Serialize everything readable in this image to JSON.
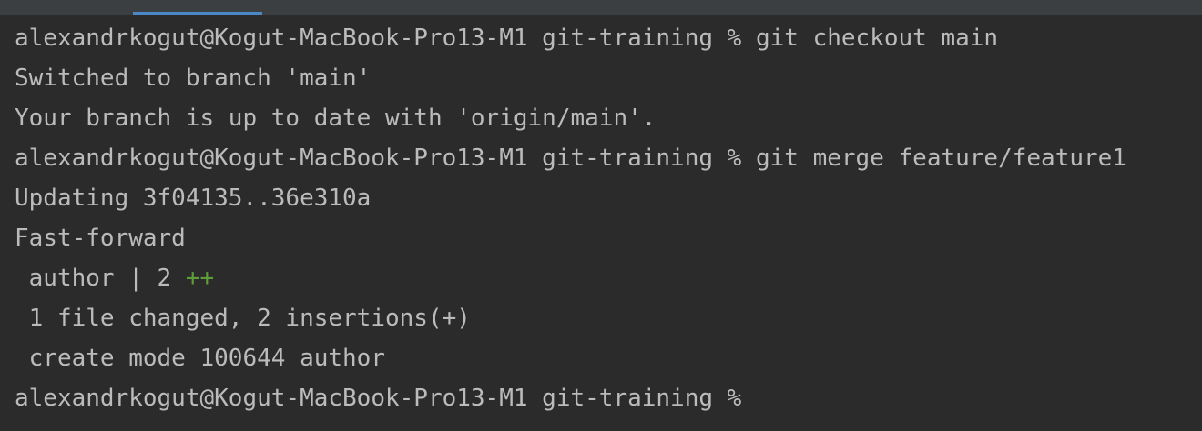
{
  "colors": {
    "background": "#2b2b2b",
    "text": "#bbbbbb",
    "tab_strip": "#3c3f41",
    "active_tab_underline": "#4a88c7",
    "diffstat_plus": "#5e9e3a"
  },
  "terminal": {
    "lines": {
      "l1": "alexandrkogut@Kogut-MacBook-Pro13-M1 git-training % git checkout main",
      "l2": "Switched to branch 'main'",
      "l3": "Your branch is up to date with 'origin/main'.",
      "l4": "alexandrkogut@Kogut-MacBook-Pro13-M1 git-training % git merge feature/feature1",
      "l5": "Updating 3f04135..36e310a",
      "l6": "Fast-forward",
      "l7_text": " author | 2 ",
      "l7_plus": "++",
      "l8": " 1 file changed, 2 insertions(+)",
      "l9": " create mode 100644 author",
      "l10": "alexandrkogut@Kogut-MacBook-Pro13-M1 git-training % "
    }
  }
}
